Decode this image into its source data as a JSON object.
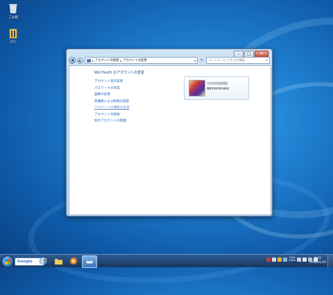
{
  "desktop": {
    "icons": [
      {
        "label": "ごみ箱",
        "icon": "recycle-bin-icon"
      },
      {
        "label": "ETC",
        "icon": "folder-icon"
      }
    ]
  },
  "window": {
    "address": {
      "crumbs": [
        "アカウントの管理",
        "アカウントの変更"
      ]
    },
    "search_placeholder": "コントロール パネルの検索",
    "heading": "Win7test5 のアカウントの変更",
    "links": [
      "アカウント名の変更",
      "パスワードの作成",
      "画像の変更",
      "保護者による制限の設定",
      "アカウントの種類の変更",
      "アカウントの削除"
    ],
    "other_link": "別のアカウントの管理",
    "user": {
      "role": "Administrator"
    }
  },
  "taskbar": {
    "search_brand": "Google",
    "clock": {
      "time": "8:43",
      "date": "2010/01/20"
    },
    "lang": [
      "Caps",
      "KANA"
    ]
  }
}
